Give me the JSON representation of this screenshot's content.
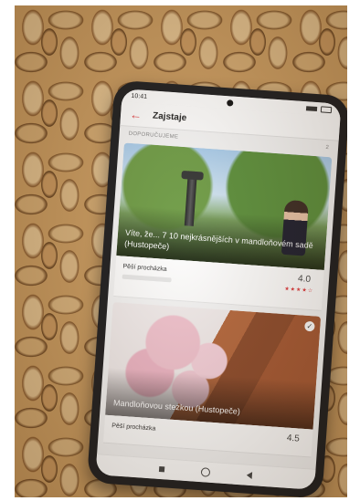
{
  "app": {
    "title": "Zajstaje",
    "back_icon": "arrow-left-icon"
  },
  "section": {
    "label": "DOPORUČUJEME",
    "count": "2"
  },
  "cards": [
    {
      "caption": "Víte, že... 7 10 nejkrásnějších v mandloňovém sadě (Hustopeče)",
      "meta_label": "Pěší procházka",
      "rating": "4.0",
      "stars": "★★★★☆"
    },
    {
      "caption": "Mandloňovou stezkou (Hustopeče)",
      "meta_label": "Pěší procházka",
      "rating": "4.5",
      "check_icon": "check-icon"
    }
  ],
  "status": {
    "time": "10:41"
  },
  "colors": {
    "accent": "#e03a3e",
    "background": "#c99a5e"
  }
}
